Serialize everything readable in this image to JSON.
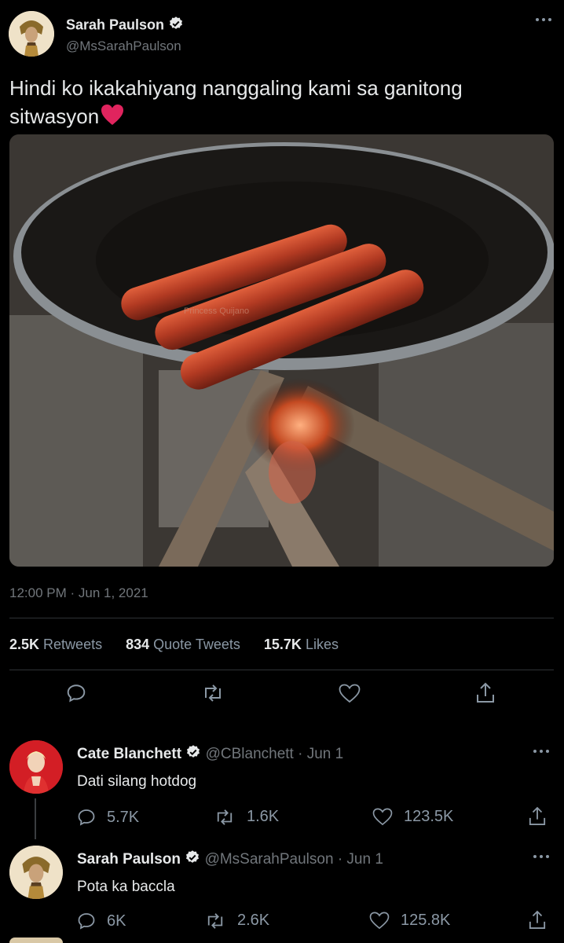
{
  "tweet": {
    "author_name": "Sarah Paulson",
    "author_handle": "@MsSarahPaulson",
    "text_line1": "Hindi ko ikakahiyang nanggaling kami sa ganitong",
    "text_line2": "sitwasyon",
    "image_watermark": "Princess Quijano",
    "timestamp": "12:00 PM · Jun 1, 2021",
    "retweets_count": "2.5K",
    "retweets_label": "Retweets",
    "quotes_count": "834",
    "quotes_label": "Quote Tweets",
    "likes_count": "15.7K",
    "likes_label": "Likes"
  },
  "replies": [
    {
      "author_name": "Cate Blanchett",
      "author_handle": "@CBlanchett",
      "date": "· Jun 1",
      "text": "Dati silang hotdog",
      "reply_count": "5.7K",
      "retweet_count": "1.6K",
      "like_count": "123.5K"
    },
    {
      "author_name": "Sarah Paulson",
      "author_handle": "@MsSarahPaulson",
      "date": "· Jun 1",
      "text": "Pota ka baccla",
      "reply_count": "6K",
      "retweet_count": "2.6K",
      "like_count": "125.8K"
    }
  ],
  "colors": {
    "background": "#000000",
    "text": "#e7e9ea",
    "muted": "#71767b",
    "heart": "#e0245e"
  }
}
